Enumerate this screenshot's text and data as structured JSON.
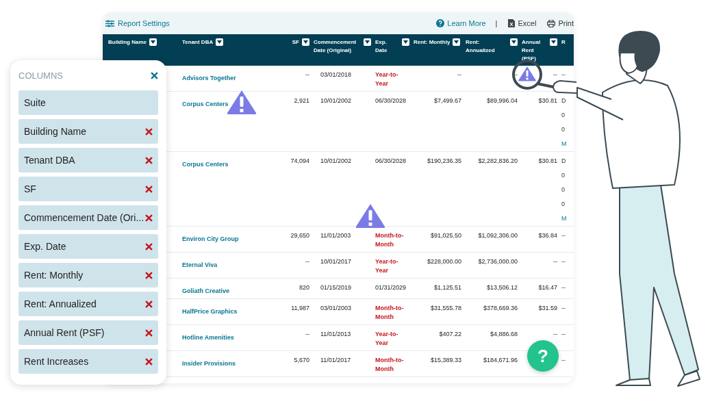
{
  "toolbar": {
    "title": "Report Settings",
    "actions": [
      {
        "kind": "help",
        "label": "Learn More"
      },
      {
        "kind": "separator",
        "label": "|"
      },
      {
        "kind": "excel",
        "label": "Excel"
      },
      {
        "kind": "print",
        "label": "Print"
      }
    ]
  },
  "table": {
    "columns": [
      "Building Name",
      "Tenant DBA",
      "SF",
      "Commencement Date (Original)",
      "Exp. Date",
      "Rent: Monthly",
      "Rent: Annualized",
      "Annual Rent (PSF)",
      "R"
    ],
    "rows": [
      {
        "tenant": "Advisors Together",
        "sf": "--",
        "commencement": "03/01/2018",
        "exp": {
          "text": "Year-to-Year",
          "rolling": true
        },
        "monthly": "--",
        "annualized": "--",
        "psf": "--",
        "last": [
          "--"
        ]
      },
      {
        "tenant": "Corpus Centers",
        "sf": "2,921",
        "commencement": "10/01/2002",
        "exp": {
          "text": "06/30/2028",
          "rolling": false
        },
        "monthly": "$7,499.67",
        "annualized": "$89,996.04",
        "psf": "$30.81",
        "last": [
          "D",
          "0",
          "0",
          "M"
        ]
      },
      {
        "tenant": "Corpus Centers",
        "sf": "74,094",
        "commencement": "10/01/2002",
        "exp": {
          "text": "06/30/2028",
          "rolling": false
        },
        "monthly": "$190,236.35",
        "annualized": "$2,282,836.20",
        "psf": "$30.81",
        "last": [
          "D",
          "0",
          "0",
          "0",
          "M"
        ]
      },
      {
        "tenant": "Environ City Group",
        "sf": "29,650",
        "commencement": "11/01/2003",
        "exp": {
          "text": "Month-to-Month",
          "rolling": true
        },
        "monthly": "$91,025.50",
        "annualized": "$1,092,306.00",
        "psf": "$36.84",
        "last": [
          "--"
        ]
      },
      {
        "tenant": "Eternal Viva",
        "sf": "--",
        "commencement": "10/01/2017",
        "exp": {
          "text": "Year-to-Year",
          "rolling": true
        },
        "monthly": "$228,000.00",
        "annualized": "$2,736,000.00",
        "psf": "--",
        "last": [
          "--"
        ]
      },
      {
        "tenant": "Goliath Creative",
        "sf": "820",
        "commencement": "01/15/2019",
        "exp": {
          "text": "01/31/2029",
          "rolling": false
        },
        "monthly": "$1,125.51",
        "annualized": "$13,506.12",
        "psf": "$16.47",
        "last": [
          "--"
        ]
      },
      {
        "tenant": "HalfPrice Graphics",
        "sf": "11,987",
        "commencement": "03/01/2003",
        "exp": {
          "text": "Month-to-Month",
          "rolling": true
        },
        "monthly": "$31,555.78",
        "annualized": "$378,669.36",
        "psf": "$31.59",
        "last": [
          "--"
        ]
      },
      {
        "tenant": "Hotline Amenities",
        "sf": "--",
        "commencement": "11/01/2013",
        "exp": {
          "text": "Year-to-Year",
          "rolling": true
        },
        "monthly": "$407.22",
        "annualized": "$4,886.68",
        "psf": "--",
        "last": [
          "--"
        ]
      },
      {
        "tenant": "Insider Provisions",
        "sf": "5,670",
        "commencement": "11/01/2017",
        "exp": {
          "text": "Month-to-Month",
          "rolling": true
        },
        "monthly": "$15,389.33",
        "annualized": "$184,671.96",
        "psf": "",
        "last": [
          "--"
        ]
      }
    ]
  },
  "columns_panel": {
    "title": "COLUMNS",
    "items": [
      {
        "label": "Suite",
        "removable": false
      },
      {
        "label": "Building Name",
        "removable": true
      },
      {
        "label": "Tenant DBA",
        "removable": true
      },
      {
        "label": "SF",
        "removable": true
      },
      {
        "label": "Commencement Date (Ori...",
        "removable": true
      },
      {
        "label": "Exp. Date",
        "removable": true
      },
      {
        "label": "Rent: Monthly",
        "removable": true
      },
      {
        "label": "Rent: Annualized",
        "removable": true
      },
      {
        "label": "Annual Rent (PSF)",
        "removable": true
      },
      {
        "label": "Rent Increases",
        "removable": true
      }
    ]
  },
  "help_button": {
    "label": "?"
  }
}
